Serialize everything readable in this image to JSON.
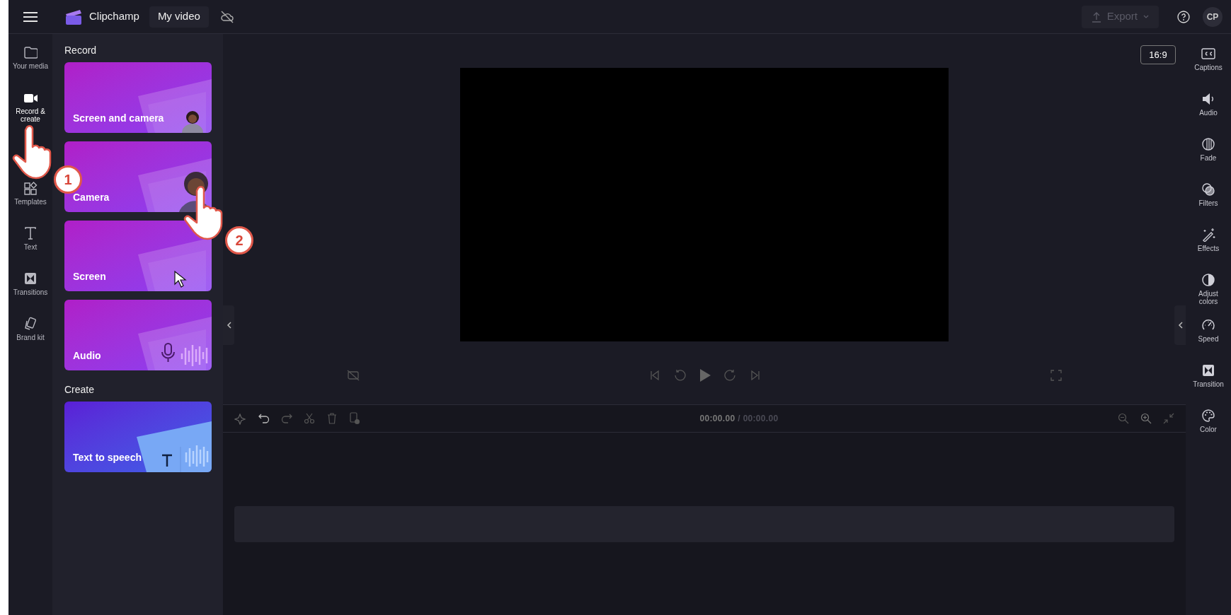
{
  "app": {
    "name": "Clipchamp",
    "project_title": "My video",
    "account_initials": "CP"
  },
  "export_button": {
    "label": "Export",
    "disabled": true
  },
  "left_nav": [
    {
      "label": "Your media",
      "selected": false
    },
    {
      "label": "Record & create",
      "selected": true
    },
    {
      "label": "Templates",
      "selected": false
    },
    {
      "label": "Text",
      "selected": false
    },
    {
      "label": "Transitions",
      "selected": false
    },
    {
      "label": "Brand kit",
      "selected": false
    }
  ],
  "panel": {
    "sections": [
      {
        "title": "Record",
        "cards": [
          {
            "label": "Screen and camera"
          },
          {
            "label": "Camera"
          },
          {
            "label": "Screen"
          },
          {
            "label": "Audio"
          }
        ]
      },
      {
        "title": "Create",
        "cards": [
          {
            "label": "Text to speech"
          }
        ]
      }
    ]
  },
  "aspect_ratio": "16:9",
  "timecode": {
    "current": "00:00.00",
    "total": "/ 00:00.00"
  },
  "right_panel": [
    {
      "label": "Captions"
    },
    {
      "label": "Audio"
    },
    {
      "label": "Fade"
    },
    {
      "label": "Filters"
    },
    {
      "label": "Effects"
    },
    {
      "label": "Adjust colors"
    },
    {
      "label": "Speed"
    },
    {
      "label": "Transition"
    },
    {
      "label": "Color"
    }
  ],
  "tutorial_pointers": [
    {
      "number": "1"
    },
    {
      "number": "2"
    }
  ]
}
